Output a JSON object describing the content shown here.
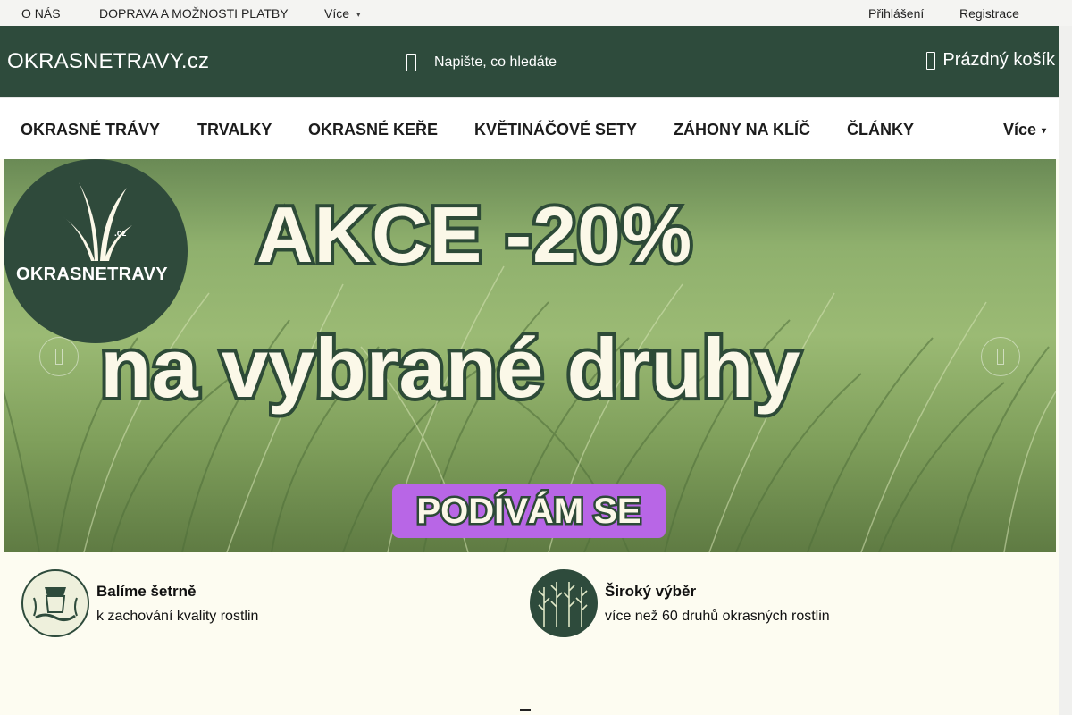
{
  "topbar": {
    "links": [
      {
        "label": "O NÁS"
      },
      {
        "label": "DOPRAVA A MOŽNOSTI PLATBY"
      },
      {
        "label": "Více"
      }
    ],
    "login_label": "Přihlášení",
    "register_label": "Registrace"
  },
  "header": {
    "logo_text": "OKRASNETRAVY.cz",
    "search_placeholder": "Napište, co hledáte",
    "cart_label": "Prázdný košík"
  },
  "nav": {
    "items": [
      {
        "label": "OKRASNÉ TRÁVY"
      },
      {
        "label": "TRVALKY"
      },
      {
        "label": "OKRASNÉ KEŘE"
      },
      {
        "label": "KVĚTINÁČOVÉ SETY"
      },
      {
        "label": "ZÁHONY NA KLÍČ"
      },
      {
        "label": "ČLÁNKY"
      }
    ],
    "more_label": "Více"
  },
  "banner": {
    "badge_cz": ".cz",
    "badge_name": "OKRASNETRAVY",
    "headline_1": "AKCE -20%",
    "headline_2": "na vybrané druhy",
    "cta_label": "PODÍVÁM SE"
  },
  "features": [
    {
      "title": "Balíme šetrně",
      "subtitle": "k zachování kvality rostlin"
    },
    {
      "title": "Široký výběr",
      "subtitle": "více než 60 druhů okrasných rostlin"
    }
  ],
  "colors": {
    "brand_dark_green": "#2e4b3c",
    "cta_purple": "#b866e6",
    "cream": "#fbf8e8"
  }
}
